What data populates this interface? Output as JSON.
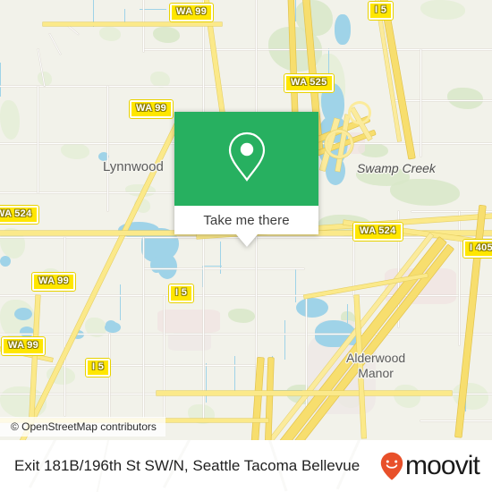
{
  "map": {
    "attribution": "© OpenStreetMap contributors",
    "places": [
      {
        "name": "Lynnwood"
      },
      {
        "name": "Alderwood",
        "name2": "Manor"
      },
      {
        "name": "Swamp Creek"
      }
    ],
    "shields": [
      {
        "label": "WA 99"
      },
      {
        "label": "I 5"
      },
      {
        "label": "WA 525"
      },
      {
        "label": "WA 99"
      },
      {
        "label": "WA 524"
      },
      {
        "label": "WA 524"
      },
      {
        "label": "I 405"
      },
      {
        "label": "WA 99"
      },
      {
        "label": "I 5"
      },
      {
        "label": "WA 99"
      },
      {
        "label": "I 5"
      }
    ],
    "colors": {
      "background": "#f2f2ea",
      "water": "#9fd3e8",
      "green": "#d8e8c8",
      "motorway": "#f7de6e",
      "shield_fill": "#ffe600"
    }
  },
  "card": {
    "cta_label": "Take me there",
    "icon": "map-pin-icon",
    "accent_color": "#27b060"
  },
  "footer": {
    "title": "Exit 181B/196th St SW/N, Seattle Tacoma Bellevue",
    "brand_name": "moovit",
    "brand_color": "#e8502a"
  }
}
